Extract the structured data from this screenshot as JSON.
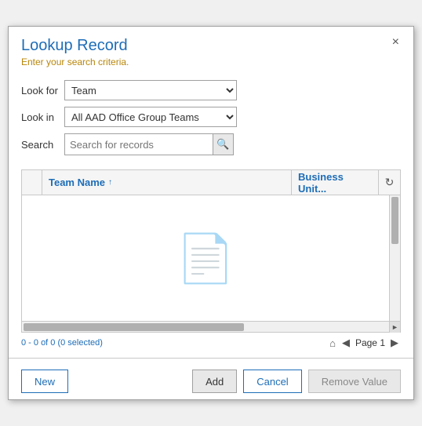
{
  "dialog": {
    "title": "Lookup Record",
    "subtitle": "Enter your search criteria.",
    "close_label": "×"
  },
  "form": {
    "look_for_label": "Look for",
    "look_in_label": "Look in",
    "search_label": "Search",
    "look_for_value": "Team",
    "look_in_value": "All AAD Office Group Teams",
    "search_placeholder": "Search for records",
    "look_for_options": [
      "Team"
    ],
    "look_in_options": [
      "All AAD Office Group Teams"
    ]
  },
  "table": {
    "col_name_label": "Team Name",
    "col_business_label": "Business Unit...",
    "sort_icon": "↑"
  },
  "status": {
    "record_count": "0 - 0 of 0 (0 selected)"
  },
  "pagination": {
    "page_label": "Page 1"
  },
  "footer": {
    "new_label": "New",
    "add_label": "Add",
    "cancel_label": "Cancel",
    "remove_value_label": "Remove Value"
  }
}
